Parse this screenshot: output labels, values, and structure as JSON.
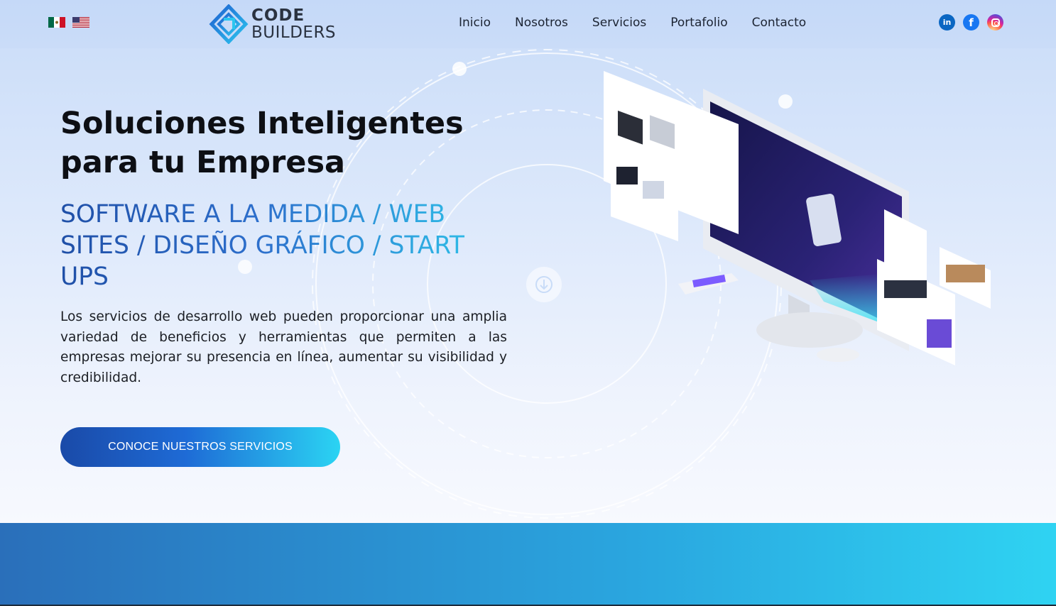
{
  "header": {
    "languages": [
      {
        "name": "es-mx",
        "icon": "mexico-flag-icon"
      },
      {
        "name": "en-us",
        "icon": "usa-flag-icon"
      }
    ],
    "logo": {
      "line1": "CODE",
      "line2": "BUILDERS"
    },
    "nav": [
      {
        "label": "Inicio"
      },
      {
        "label": "Nosotros"
      },
      {
        "label": "Servicios"
      },
      {
        "label": "Portafolio"
      },
      {
        "label": "Contacto"
      }
    ],
    "social": [
      {
        "name": "linkedin",
        "icon": "linkedin-icon",
        "glyph": "in"
      },
      {
        "name": "facebook",
        "icon": "facebook-icon",
        "glyph": "f"
      },
      {
        "name": "instagram",
        "icon": "instagram-icon"
      }
    ]
  },
  "hero": {
    "headline": "Soluciones Inteligentes para tu Empresa",
    "subheadline": "SOFTWARE A LA MEDIDA / WEB SITES / DISEÑO GRÁFICO / START UPS",
    "description": "Los servicios de desarrollo web pueden proporcionar una amplia variedad de beneficios y herramientas que permiten a las empresas mejorar su presencia en línea, aumentar su visibilidad y credibilidad.",
    "cta_label": "CONOCE NUESTROS SERVICIOS",
    "scroll_icon": "arrow-down-icon"
  },
  "colors": {
    "accent_dark": "#1a4aa8",
    "accent_light": "#2bd4f3",
    "heading": "#0d0f14"
  }
}
